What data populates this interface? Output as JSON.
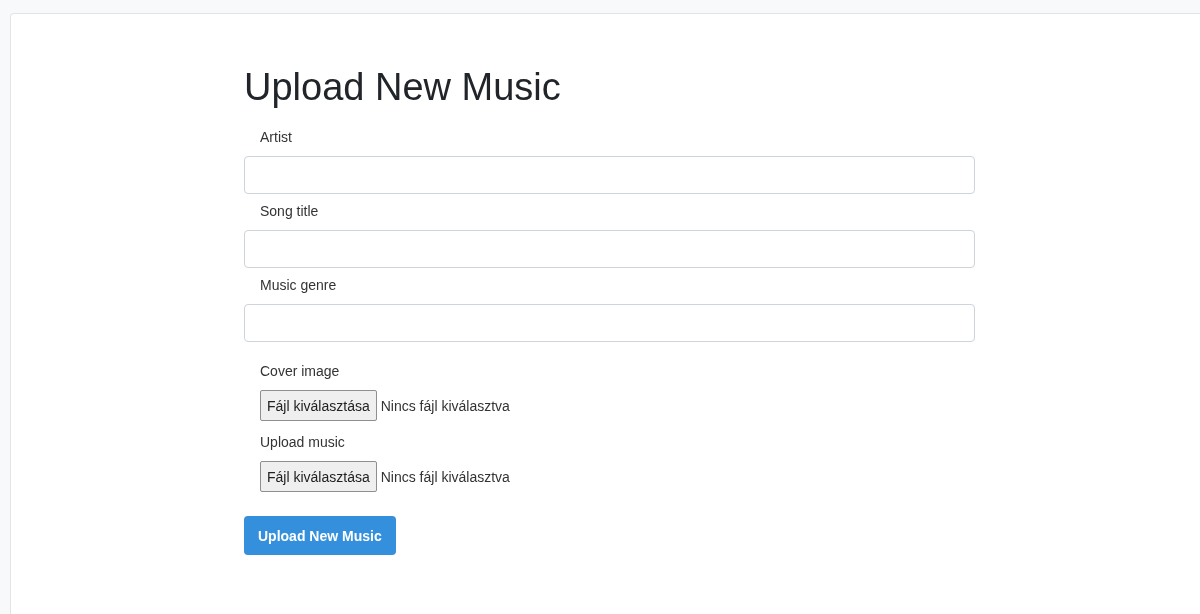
{
  "title": "Upload New Music",
  "fields": [
    {
      "kind": "text",
      "label": "Artist"
    },
    {
      "kind": "text",
      "label": "Song title"
    },
    {
      "kind": "text",
      "label": "Music genre"
    },
    {
      "kind": "file",
      "label": "Cover image",
      "button": "Fájl kiválasztása",
      "status": "Nincs fájl kiválasztva"
    },
    {
      "kind": "file",
      "label": "Upload music",
      "button": "Fájl kiválasztása",
      "status": "Nincs fájl kiválasztva"
    }
  ],
  "submit": "Upload New Music"
}
